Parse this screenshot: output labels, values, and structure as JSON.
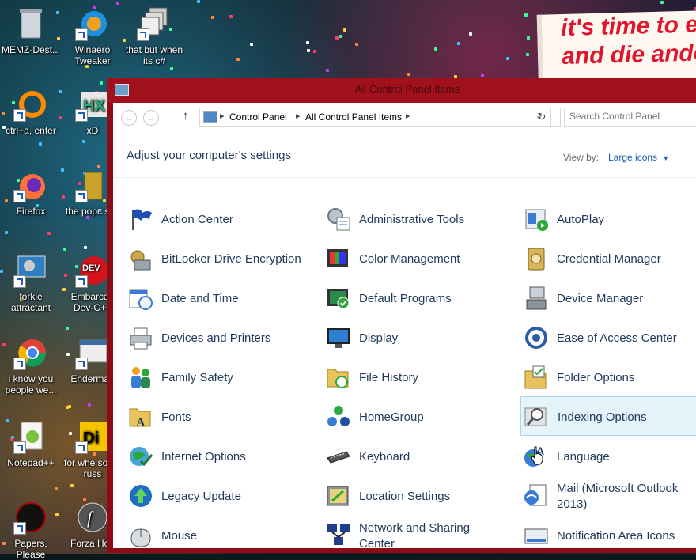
{
  "window": {
    "title": "All Control Panel Items"
  },
  "address_bar": {
    "crumbs": [
      "Control Panel",
      "All Control Panel Items"
    ]
  },
  "search": {
    "placeholder": "Search Control Panel"
  },
  "header": {
    "title": "Adjust your computer's settings",
    "view_by_label": "View by:",
    "view_by_value": "Large icons"
  },
  "banner": {
    "line1": "it's time to e",
    "line2": "and die ande"
  },
  "desktop_icons": [
    {
      "label": "MEMZ-Dest..."
    },
    {
      "label": "Winaero Tweaker"
    },
    {
      "label": "that but when its c#"
    },
    {
      "label": "ctrl+a, enter"
    },
    {
      "label": "xD"
    },
    {
      "label": "Firefox"
    },
    {
      "label": "the popc shit"
    },
    {
      "label": "forkie attractant"
    },
    {
      "label": "Embarcad Dev-C++"
    },
    {
      "label": "i know you people we..."
    },
    {
      "label": "Enderman"
    },
    {
      "label": "Notepad++"
    },
    {
      "label": "for whe some russ"
    },
    {
      "label": "Papers, Please"
    },
    {
      "label": "Forza Hori"
    }
  ],
  "items": [
    {
      "label": "Action Center",
      "icon": "flag-icon"
    },
    {
      "label": "Administrative Tools",
      "icon": "admin-tools-icon"
    },
    {
      "label": "AutoPlay",
      "icon": "autoplay-icon"
    },
    {
      "label": "BitLocker Drive Encryption",
      "icon": "bitlocker-icon"
    },
    {
      "label": "Color Management",
      "icon": "color-management-icon"
    },
    {
      "label": "Credential Manager",
      "icon": "credential-manager-icon"
    },
    {
      "label": "Date and Time",
      "icon": "calendar-clock-icon"
    },
    {
      "label": "Default Programs",
      "icon": "default-programs-icon"
    },
    {
      "label": "Device Manager",
      "icon": "device-manager-icon"
    },
    {
      "label": "Devices and Printers",
      "icon": "printer-icon"
    },
    {
      "label": "Display",
      "icon": "display-icon"
    },
    {
      "label": "Ease of Access Center",
      "icon": "ease-of-access-icon"
    },
    {
      "label": "Family Safety",
      "icon": "family-safety-icon"
    },
    {
      "label": "File History",
      "icon": "file-history-icon"
    },
    {
      "label": "Folder Options",
      "icon": "folder-options-icon"
    },
    {
      "label": "Fonts",
      "icon": "fonts-folder-icon"
    },
    {
      "label": "HomeGroup",
      "icon": "homegroup-icon"
    },
    {
      "label": "Indexing Options",
      "icon": "indexing-options-icon"
    },
    {
      "label": "Internet Options",
      "icon": "internet-options-icon"
    },
    {
      "label": "Keyboard",
      "icon": "keyboard-icon"
    },
    {
      "label": "Language",
      "icon": "language-icon"
    },
    {
      "label": "Legacy Update",
      "icon": "legacy-update-icon"
    },
    {
      "label": "Location Settings",
      "icon": "location-settings-icon"
    },
    {
      "label": "Mail (Microsoft Outlook 2013)",
      "icon": "mail-icon"
    },
    {
      "label": "Mouse",
      "icon": "mouse-icon"
    },
    {
      "label": "Network and Sharing Center",
      "icon": "network-sharing-icon"
    },
    {
      "label": "Notification Area Icons",
      "icon": "notification-area-icon"
    }
  ]
}
